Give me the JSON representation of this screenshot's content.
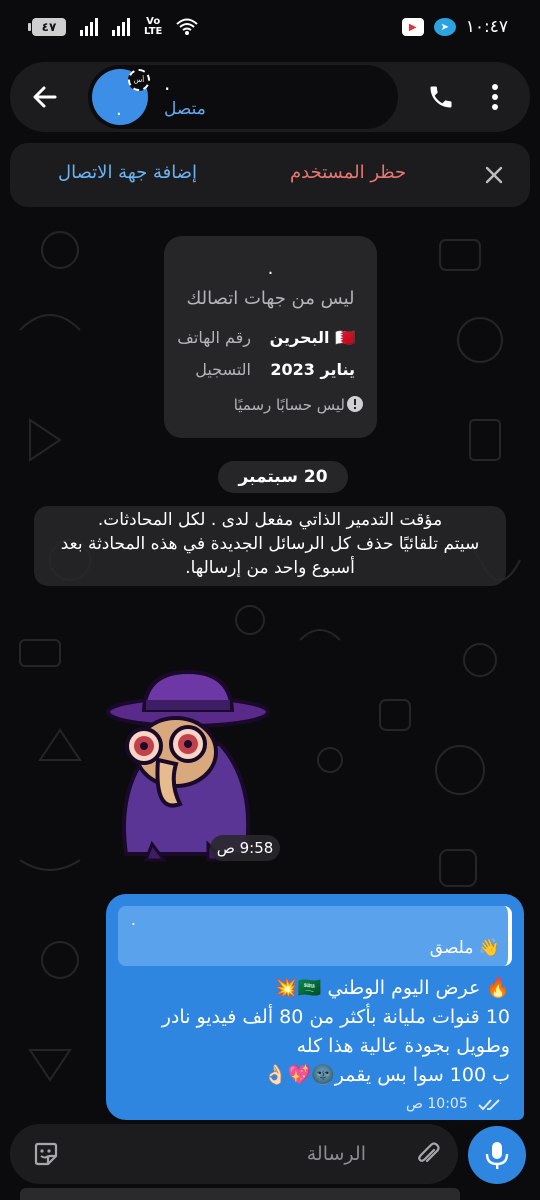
{
  "status_bar": {
    "time": "١٠:٤٧",
    "battery": "٤٧",
    "network": "Vo\nLTE"
  },
  "header": {
    "contact_name": ".",
    "contact_status": "متصل",
    "avatar_initial": ".",
    "timer_badge": "أس"
  },
  "action_bar": {
    "block_label": "حظر المستخدم",
    "add_contact_label": "إضافة جهة الاتصال"
  },
  "info_card": {
    "name": ".",
    "subtitle": "ليس من جهات اتصالك",
    "phone_label": "رقم الهاتف",
    "phone_value": "البحرين",
    "phone_flag": "🇧🇭",
    "registered_label": "التسجيل",
    "registered_value": "يناير 2023",
    "official_note": "ليس حسابًا رسميًا"
  },
  "chat": {
    "date_chip": "20 سبتمبر",
    "service_message_line1": "مؤقت التدمير الذاتي مفعل لدى . لكل المحادثات.",
    "service_message_line2": "سيتم تلقائيًا حذف كل الرسائل الجديدة في هذه المحادثة بعد",
    "service_message_line3": "أسبوع واحد من إرسالها.",
    "sticker_time": "9:58 ص",
    "outgoing": {
      "reply_name": ".",
      "reply_text": "👋 ملصق",
      "line1": "🔥 عرض اليوم الوطني 🇸🇦💥",
      "line2": "10 قنوات مليانة بأكثر من 80 ألف فيديو نادر",
      "line3": "وطويل بجودة عالية هذا كله",
      "line4": "ب 100 سوا بس يقمر🌚💖👌🏻",
      "time": "10:05 ص"
    }
  },
  "input": {
    "placeholder": "الرسالة"
  },
  "colors": {
    "accent_blue": "#2f86e0",
    "status_online": "#62a9ee",
    "block_red": "#e8786f",
    "add_blue": "#6ab3f3"
  }
}
